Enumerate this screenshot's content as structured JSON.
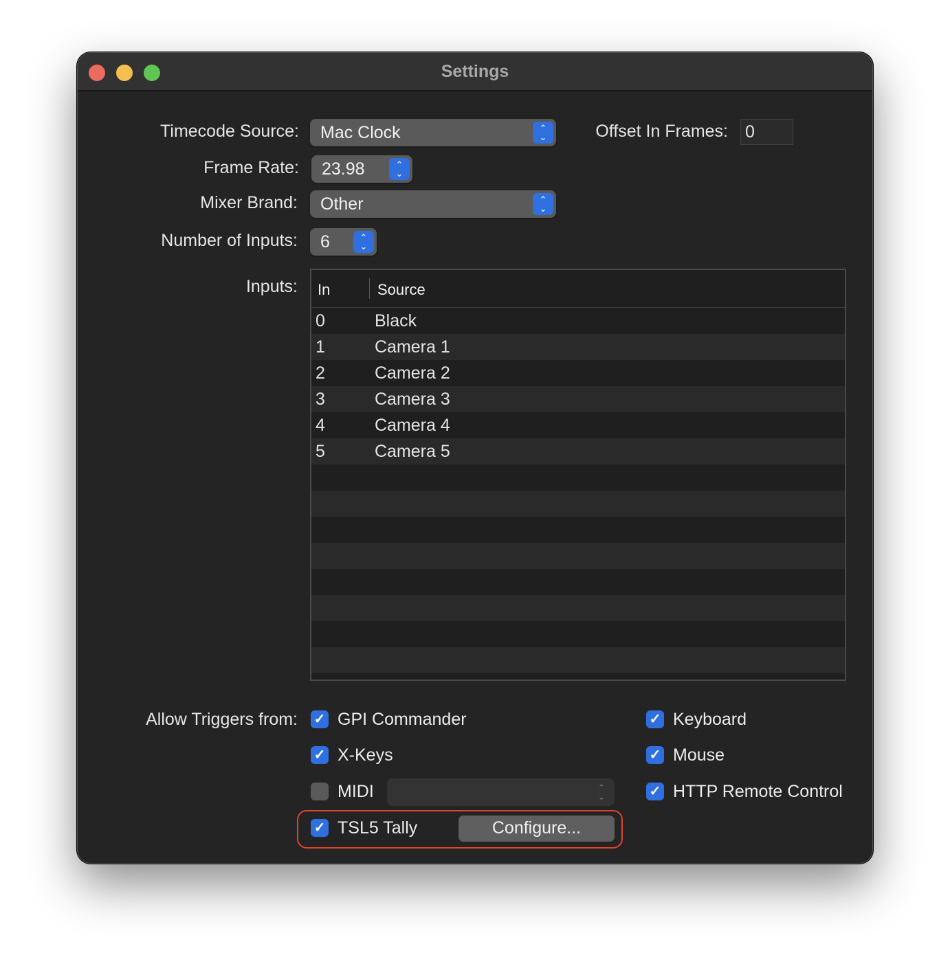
{
  "window": {
    "title": "Settings"
  },
  "form": {
    "timecode_source": {
      "label": "Timecode Source:",
      "value": "Mac Clock"
    },
    "offset": {
      "label": "Offset In Frames:",
      "value": "0"
    },
    "frame_rate": {
      "label": "Frame Rate:",
      "value": "23.98"
    },
    "mixer_brand": {
      "label": "Mixer Brand:",
      "value": "Other"
    },
    "num_inputs": {
      "label": "Number of Inputs:",
      "value": "6"
    },
    "inputs_label": "Inputs:"
  },
  "table": {
    "columns": [
      "In",
      "Source"
    ],
    "rows": [
      [
        "0",
        "Black"
      ],
      [
        "1",
        "Camera 1"
      ],
      [
        "2",
        "Camera 2"
      ],
      [
        "3",
        "Camera 3"
      ],
      [
        "4",
        "Camera 4"
      ],
      [
        "5",
        "Camera 5"
      ]
    ]
  },
  "triggers": {
    "label": "Allow Triggers from:",
    "gpi": {
      "label": "GPI Commander",
      "checked": true
    },
    "xkeys": {
      "label": "X-Keys",
      "checked": true
    },
    "midi": {
      "label": "MIDI",
      "checked": false,
      "value": ""
    },
    "tsl5": {
      "label": "TSL5 Tally",
      "checked": true
    },
    "configure": "Configure...",
    "keyboard": {
      "label": "Keyboard",
      "checked": true
    },
    "mouse": {
      "label": "Mouse",
      "checked": true
    },
    "http": {
      "label": "HTTP Remote Control",
      "checked": true
    }
  },
  "colors": {
    "accent": "#2f6fe0",
    "highlight": "#e0442c"
  }
}
